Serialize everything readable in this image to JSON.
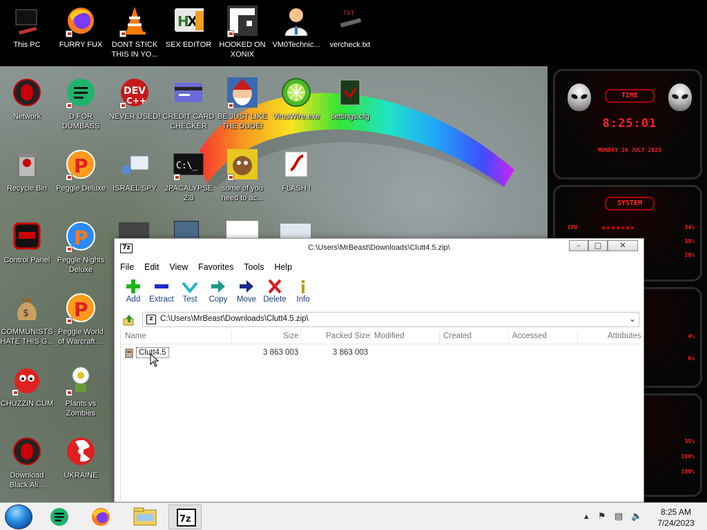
{
  "desktop": {
    "icons_top": [
      {
        "label": "This PC"
      },
      {
        "label": "FURRY FUX"
      },
      {
        "label": "DONT STICK THIS IN YO..."
      },
      {
        "label": "SEX EDITOR"
      },
      {
        "label": "HOOKED ON XONIX"
      },
      {
        "label": "VM0Technic..."
      },
      {
        "label": "vercheck.txt"
      }
    ],
    "icons": [
      {
        "label": "Network"
      },
      {
        "label": "D FOR DUMBASS"
      },
      {
        "label": "NEVER USED!"
      },
      {
        "label": "CREDIT CARD CHECKER"
      },
      {
        "label": "BE JUST LIKE THE DUDE!"
      },
      {
        "label": "VirusWire.exe"
      },
      {
        "label": "settings.cfg"
      },
      {
        "label": "Recycle Bin"
      },
      {
        "label": "Peggle Deluxe"
      },
      {
        "label": "ISRAEL SPY"
      },
      {
        "label": "2PACALYPSE 2.3"
      },
      {
        "label": "some of you need to ac..."
      },
      {
        "label": "FLASH !"
      },
      {
        "label": "Control Panel"
      },
      {
        "label": "Peggle Nights Deluxe"
      },
      {
        "label": "COMMUNISTS HATE THIS G..."
      },
      {
        "label": "Peggle World of Warcraft ..."
      },
      {
        "label": "CHUZZIN CUM"
      },
      {
        "label": "Plants vs Zombies"
      },
      {
        "label": "Download Black Ali..."
      },
      {
        "label": "UKRAINE"
      }
    ]
  },
  "gadget": {
    "time_title": "TIME",
    "time": "8:25:01",
    "date": "MONDAY 24 JULY 2023",
    "system_title": "SYSTEM",
    "cpu_label": "CPU",
    "cpu_vals": [
      "34%",
      "38%",
      "28%"
    ],
    "mid_vals": [
      "4%",
      "6%"
    ],
    "bottom_vals": [
      "35%",
      "100%",
      "100%"
    ]
  },
  "window": {
    "title": "C:\\Users\\MrBeast\\Downloads\\Clutt4.5.zip\\",
    "app_icon": "7z",
    "menus": [
      "File",
      "Edit",
      "View",
      "Favorites",
      "Tools",
      "Help"
    ],
    "toolbar": [
      {
        "label": "Add",
        "icon": "plus-icon"
      },
      {
        "label": "Extract",
        "icon": "minus-icon"
      },
      {
        "label": "Test",
        "icon": "check-icon"
      },
      {
        "label": "Copy",
        "icon": "arrow-right-icon"
      },
      {
        "label": "Move",
        "icon": "arrow-move-icon"
      },
      {
        "label": "Delete",
        "icon": "x-icon"
      },
      {
        "label": "Info",
        "icon": "info-icon"
      }
    ],
    "address": "C:\\Users\\MrBeast\\Downloads\\Clutt4.5.zip\\",
    "columns": [
      "Name",
      "Size",
      "Packed Size",
      "Modified",
      "Created",
      "Accessed",
      "Attributes"
    ],
    "rows": [
      {
        "name": "Clutt4.5",
        "size": "3 863 003",
        "packed": "3 863 003"
      }
    ]
  },
  "taskbar": {
    "clock_time": "8:25 AM",
    "clock_date": "7/24/2023",
    "apps": [
      "start-orb",
      "spreadsheets-app",
      "firefox",
      "file-explorer",
      "7-zip"
    ]
  },
  "colors": {
    "gadget_red": "#ff2020",
    "toolbar_label": "#1c3c7a",
    "taskbar": "#f0f0f0"
  }
}
